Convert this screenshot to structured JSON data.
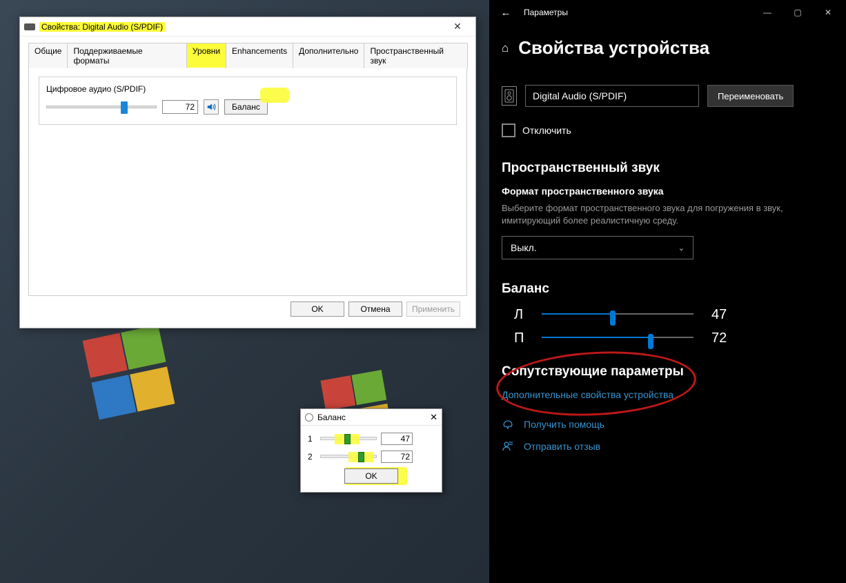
{
  "props_dialog": {
    "title": "Свойства: Digital Audio (S/PDIF)",
    "tabs": [
      "Общие",
      "Поддерживаемые форматы",
      "Уровни",
      "Enhancements",
      "Дополнительно",
      "Пространственный звук"
    ],
    "active_tab": 2,
    "group_title": "Цифровое аудио (S/PDIF)",
    "level_value": "72",
    "slider_percent": 72,
    "balance_btn": "Баланс",
    "ok": "OK",
    "cancel": "Отмена",
    "apply": "Применить"
  },
  "balance_dialog": {
    "title": "Баланс",
    "rows": [
      {
        "label": "1",
        "value": "47",
        "percent": 47
      },
      {
        "label": "2",
        "value": "72",
        "percent": 72
      }
    ],
    "ok": "OK"
  },
  "settings": {
    "app": "Параметры",
    "page_title": "Свойства устройства",
    "device_name": "Digital Audio (S/PDIF)",
    "rename": "Переименовать",
    "disable": "Отключить",
    "spatial": {
      "heading": "Пространственный звук",
      "subheading": "Формат пространственного звука",
      "desc": "Выберите формат пространственного звука для погружения в звук, имитирующий более реалистичную среду.",
      "selected": "Выкл."
    },
    "balance": {
      "heading": "Баланс",
      "left_label": "Л",
      "left_value": "47",
      "left_percent": 47,
      "right_label": "П",
      "right_value": "72",
      "right_percent": 72
    },
    "related": {
      "heading": "Сопутствующие параметры",
      "link": "Дополнительные свойства устройства"
    },
    "help": "Получить помощь",
    "feedback": "Отправить отзыв"
  }
}
